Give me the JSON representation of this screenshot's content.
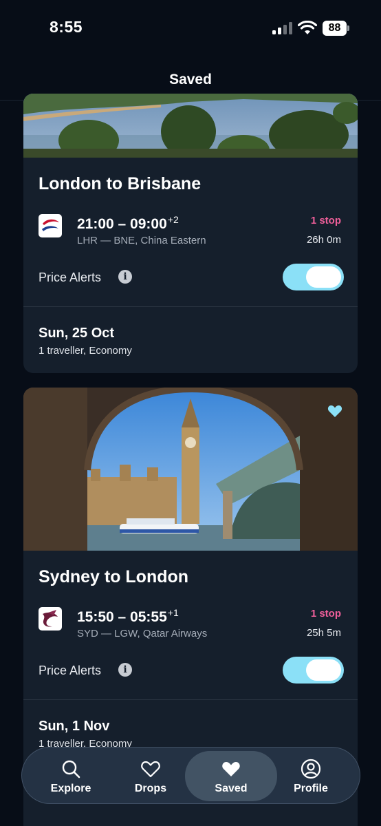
{
  "status_bar": {
    "time": "8:55",
    "battery": "88",
    "icons": [
      "cellular-signal-icon",
      "wifi-icon",
      "battery-icon"
    ]
  },
  "header": {
    "title": "Saved"
  },
  "trips": [
    {
      "route": "London to Brisbane",
      "airline_logo": "china-eastern-logo",
      "times": "21:00 – 09:00",
      "day_offset": "+2",
      "route_detail": "LHR — BNE, China Eastern",
      "stops": "1 stop",
      "duration": "26h 0m",
      "price_alerts_label": "Price Alerts",
      "price_alerts_on": true,
      "date": "Sun, 25 Oct",
      "passengers": "1 traveller, Economy"
    },
    {
      "route": "Sydney to London",
      "airline_logo": "qatar-airways-logo",
      "times": "15:50 – 05:55",
      "day_offset": "+1",
      "route_detail": "SYD — LGW, Qatar Airways",
      "stops": "1 stop",
      "duration": "25h 5m",
      "price_alerts_label": "Price Alerts",
      "price_alerts_on": true,
      "date": "Sun, 1 Nov",
      "passengers": "1 traveller, Economy",
      "saved": true
    }
  ],
  "colors": {
    "accent_toggle": "#8be0f7",
    "stops": "#ef5f9a",
    "card_bg": "#151f2c",
    "page_bg": "#070d17"
  },
  "nav": {
    "items": [
      {
        "label": "Explore",
        "icon": "search-icon"
      },
      {
        "label": "Drops",
        "icon": "heart-outline-icon"
      },
      {
        "label": "Saved",
        "icon": "heart-filled-icon",
        "active": true
      },
      {
        "label": "Profile",
        "icon": "profile-icon"
      }
    ]
  }
}
